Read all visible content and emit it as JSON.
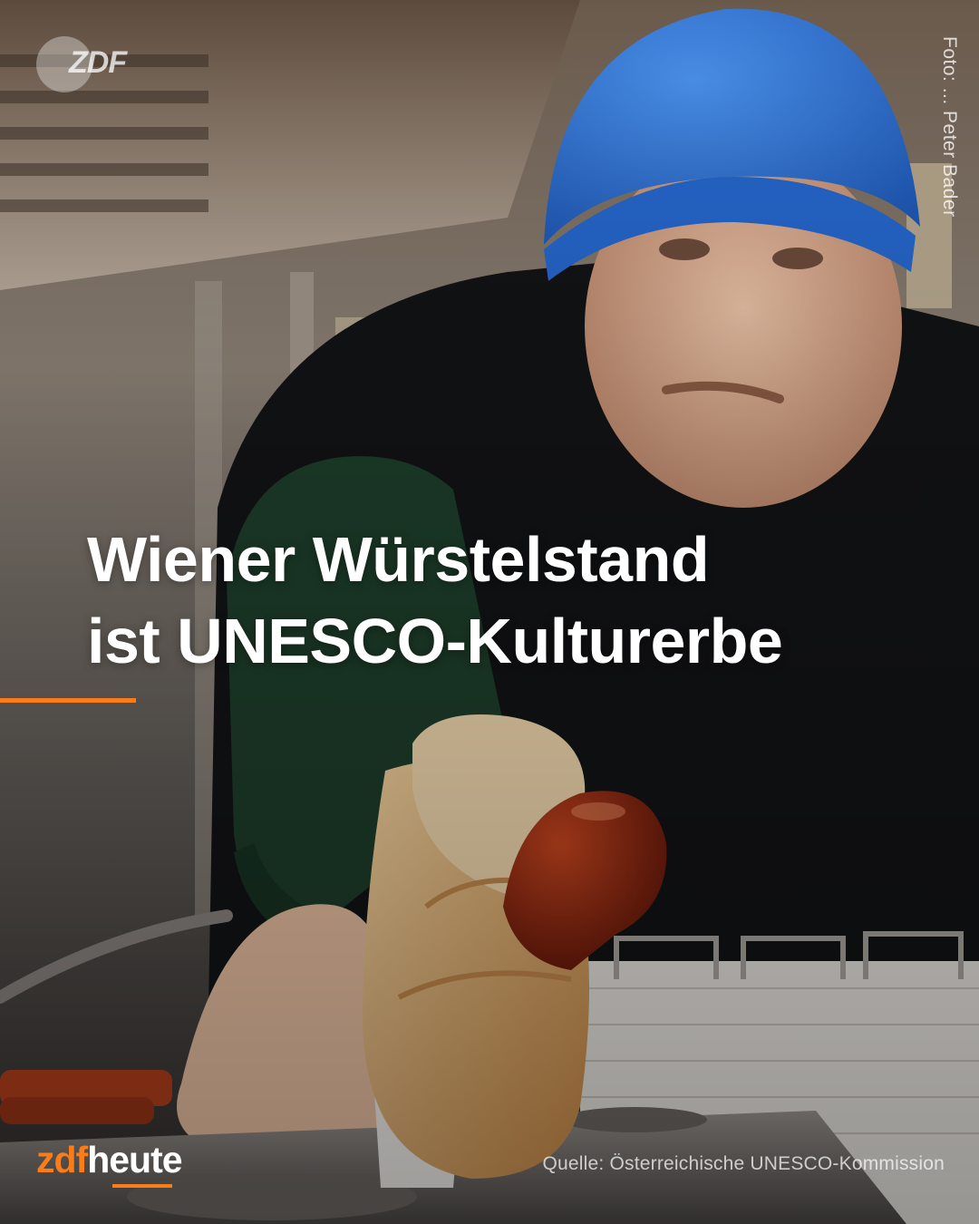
{
  "photo": {
    "description_icon": "sausage-stand-photo",
    "colors": {
      "beanie": "#2f6fd4",
      "vest": "#111214",
      "sleeve": "#1d3d2a",
      "bun": "#e6b87a",
      "sausage": "#8e1e0d"
    }
  },
  "watermark": {
    "logo_text": "ZDF"
  },
  "credit": {
    "text": "Foto: ... Peter Bader"
  },
  "headline": {
    "line1": "Wiener Würstelstand",
    "line2": "ist UNESCO-Kulturerbe"
  },
  "accent_color": "#fa7d19",
  "brand": {
    "part1": "zdf",
    "part2": "heute"
  },
  "source": {
    "text": "Quelle: Österreichische UNESCO-Kommission"
  }
}
